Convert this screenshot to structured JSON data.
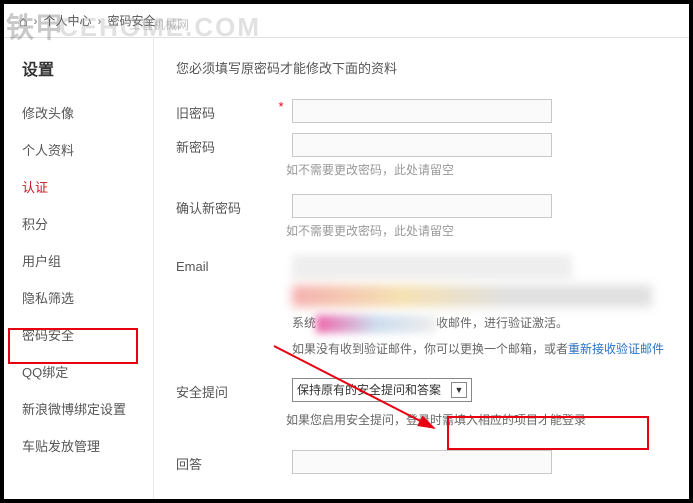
{
  "watermarks": {
    "tiejia": "铁甲",
    "cehome": "CEHOME",
    "sub": "工程机械网",
    "dotcom": ".COM"
  },
  "breadcrumb": {
    "item1": "个人中心",
    "item2": "密码安全"
  },
  "sidebar": {
    "title": "设置",
    "items": [
      {
        "label": "修改头像"
      },
      {
        "label": "个人资料"
      },
      {
        "label": "认证"
      },
      {
        "label": "积分"
      },
      {
        "label": "用户组"
      },
      {
        "label": "隐私筛选"
      },
      {
        "label": "密码安全"
      },
      {
        "label": "QQ绑定"
      },
      {
        "label": "新浪微博绑定设置"
      },
      {
        "label": "车贴发放管理"
      }
    ]
  },
  "form": {
    "notice": "您必须填写原密码才能修改下面的资料",
    "old_pwd_label": "旧密码",
    "new_pwd_label": "新密码",
    "new_pwd_hint": "如不需要更改密码，此处请留空",
    "confirm_pwd_label": "确认新密码",
    "confirm_pwd_hint": "如不需要更改密码，此处请留空",
    "email_label": "Email",
    "email_hint_prefix": "系统",
    "email_hint_mid": "收邮件，进行验证激活。",
    "email_hint2": "如果没有收到验证邮件，你可以更换一个邮箱，或者",
    "email_resend_link": "重新接收验证邮件",
    "security_q_label": "安全提问",
    "security_q_value": "保持原有的安全提问和答案",
    "security_q_hint": "如果您启用安全提问，登录时需填入相应的项目才能登录",
    "answer_label": "回答",
    "required_mark": "*"
  }
}
